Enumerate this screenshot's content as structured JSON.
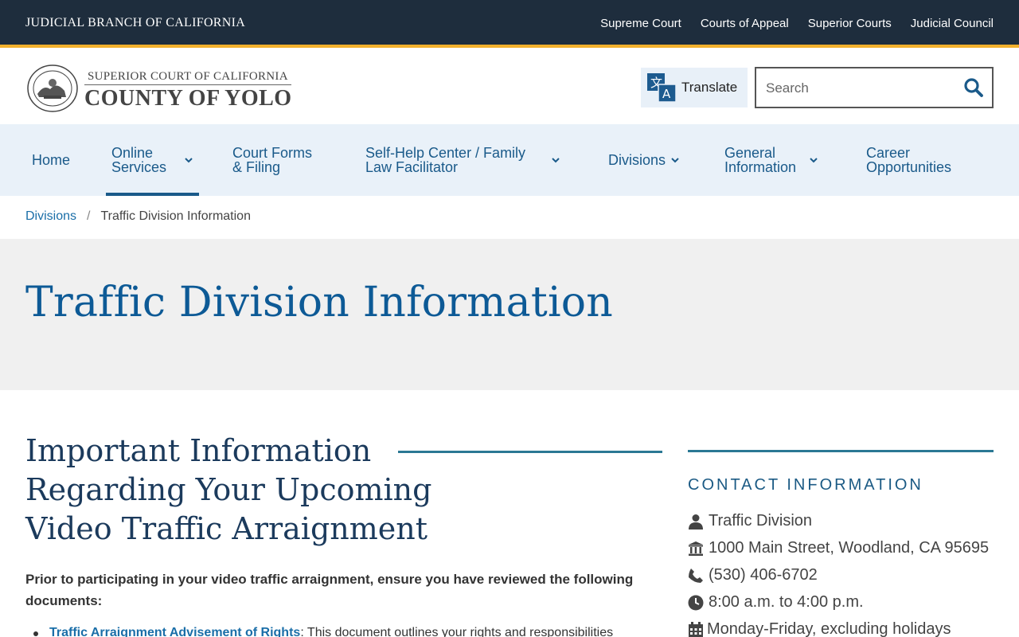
{
  "topbar": {
    "brand": "JUDICIAL BRANCH OF CALIFORNIA",
    "links": [
      "Supreme Court",
      "Courts of Appeal",
      "Superior Courts",
      "Judicial Council"
    ]
  },
  "header": {
    "logo_small": "SUPERIOR COURT OF CALIFORNIA",
    "logo_main": "COUNTY OF YOLO",
    "seal_text": "JUDICIAL BRANCH OF CALIFORNIA",
    "translate_label": "Translate",
    "search_placeholder": "Search"
  },
  "nav": {
    "items": [
      {
        "line1": "Home",
        "line2": "",
        "dropdown": false,
        "active": false
      },
      {
        "line1": "Online",
        "line2": "Services",
        "dropdown": true,
        "active": true
      },
      {
        "line1": "Court Forms",
        "line2": "& Filing",
        "dropdown": false,
        "active": false
      },
      {
        "line1": "Self-Help Center / Family",
        "line2": "Law Facilitator",
        "dropdown": true,
        "active": false
      },
      {
        "line1": "Divisions",
        "line2": "",
        "dropdown": true,
        "active": false
      },
      {
        "line1": "General",
        "line2": "Information",
        "dropdown": true,
        "active": false
      },
      {
        "line1": "Career",
        "line2": "Opportunities",
        "dropdown": false,
        "active": false
      }
    ]
  },
  "breadcrumb": {
    "parent": "Divisions",
    "separator": "/",
    "current": "Traffic Division Information"
  },
  "page": {
    "title": "Traffic Division Information",
    "section_heading_lines": [
      "Important Information",
      "Regarding Your Upcoming",
      "Video Traffic Arraignment"
    ],
    "intro": "Prior to participating in your video traffic arraignment, ensure you have reviewed the following documents:",
    "list": [
      {
        "link": "Traffic Arraignment Advisement of Rights",
        "text": ": This document outlines your rights and responsibilities"
      }
    ]
  },
  "sidebar": {
    "title": "CONTACT INFORMATION",
    "contacts": [
      {
        "icon": "user-icon",
        "text": "Traffic Division"
      },
      {
        "icon": "building-icon",
        "text": "1000 Main Street, Woodland, CA 95695"
      },
      {
        "icon": "phone-icon",
        "text": "(530) 406-6702"
      },
      {
        "icon": "clock-icon",
        "text": "8:00 a.m. to 4:00 p.m."
      },
      {
        "icon": "calendar-icon",
        "text": "Monday-Friday, excluding holidays"
      }
    ]
  },
  "colors": {
    "topbar_bg": "#1e2d3d",
    "accent_gold": "#f2b02c",
    "nav_bg": "#e9f1f9",
    "link_blue": "#1a6ea8",
    "title_blue": "#0d5a96",
    "rule_teal": "#2b7894"
  }
}
